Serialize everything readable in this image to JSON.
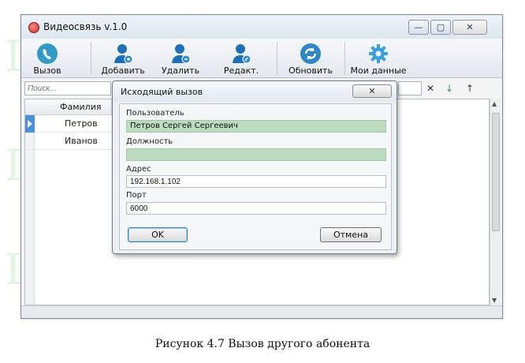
{
  "window": {
    "title": "Видеосвязь v.1.0",
    "controls": {
      "minimize": "—",
      "maximize": "▢",
      "close": "✕"
    }
  },
  "toolbar": {
    "buttons": [
      {
        "label": "Вызов",
        "icon": "phone-call-icon"
      },
      {
        "label": "Добавить",
        "icon": "add-user-icon"
      },
      {
        "label": "Удалить",
        "icon": "remove-user-icon"
      },
      {
        "label": "Редакт.",
        "icon": "edit-user-icon"
      },
      {
        "label": "Обновить",
        "icon": "refresh-icon"
      },
      {
        "label": "Мои данные",
        "icon": "settings-gear-icon"
      }
    ]
  },
  "search": {
    "placeholder": "Поиск..."
  },
  "list": {
    "column_header": "Фамилия",
    "rows": [
      "Петров",
      "Иванов"
    ]
  },
  "dialog": {
    "title": "Исходящий вызов",
    "close": "✕",
    "fields": {
      "user_label": "Пользователь",
      "user_value": "Петров Сергей Сергеевич",
      "position_label": "Должность",
      "position_value": "",
      "address_label": "Адрес",
      "address_value": "192.168.1.102",
      "port_label": "Порт",
      "port_value": "6000"
    },
    "ok_button": "OK",
    "cancel_button": "Отмена"
  },
  "caption": "Рисунок 4.7 Вызов другого абонента",
  "watermark": "Diplom-it.ru",
  "colors": {
    "accent": "#3c7fb1",
    "readonly_field": "#bcdcc0",
    "row_indicator": "#4a90d9",
    "watermark": "#3cc83c"
  }
}
